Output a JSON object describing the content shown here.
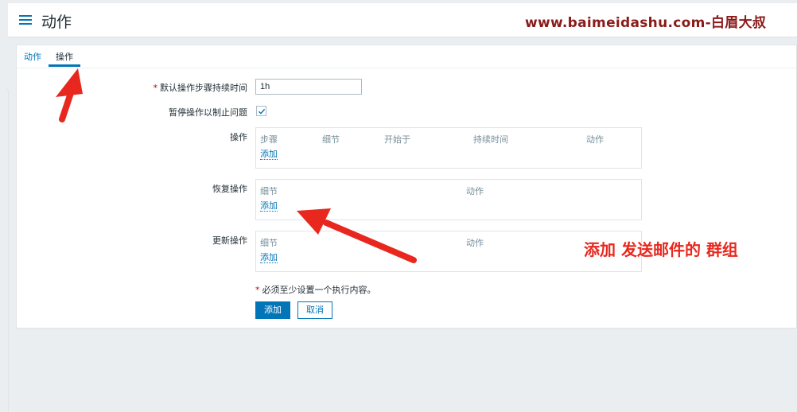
{
  "header": {
    "title": "动作",
    "watermark": "www.baimeidashu.com-白眉大叔"
  },
  "tabs": [
    {
      "label": "动作",
      "active": false
    },
    {
      "label": "操作",
      "active": true
    }
  ],
  "form": {
    "default_duration_label": "默认操作步骤持续时间",
    "default_duration_value": "1h",
    "pause_label": "暂停操作以制止问题",
    "pause_checked": true,
    "operations": {
      "label": "操作",
      "columns": [
        "步骤",
        "细节",
        "开始于",
        "持续时间",
        "动作"
      ],
      "add_label": "添加"
    },
    "recovery": {
      "label": "恢复操作",
      "columns": [
        "细节",
        "动作"
      ],
      "add_label": "添加"
    },
    "update": {
      "label": "更新操作",
      "columns": [
        "细节",
        "动作"
      ],
      "add_label": "添加"
    },
    "note": "必须至少设置一个执行内容。",
    "add_button": "添加",
    "cancel_button": "取消"
  },
  "annotation": {
    "text": "添加 发送邮件的 群组",
    "color": "#e8281e"
  },
  "colors": {
    "accent": "#0275b8",
    "required": "#d40000",
    "annotation_red": "#e8281e"
  }
}
